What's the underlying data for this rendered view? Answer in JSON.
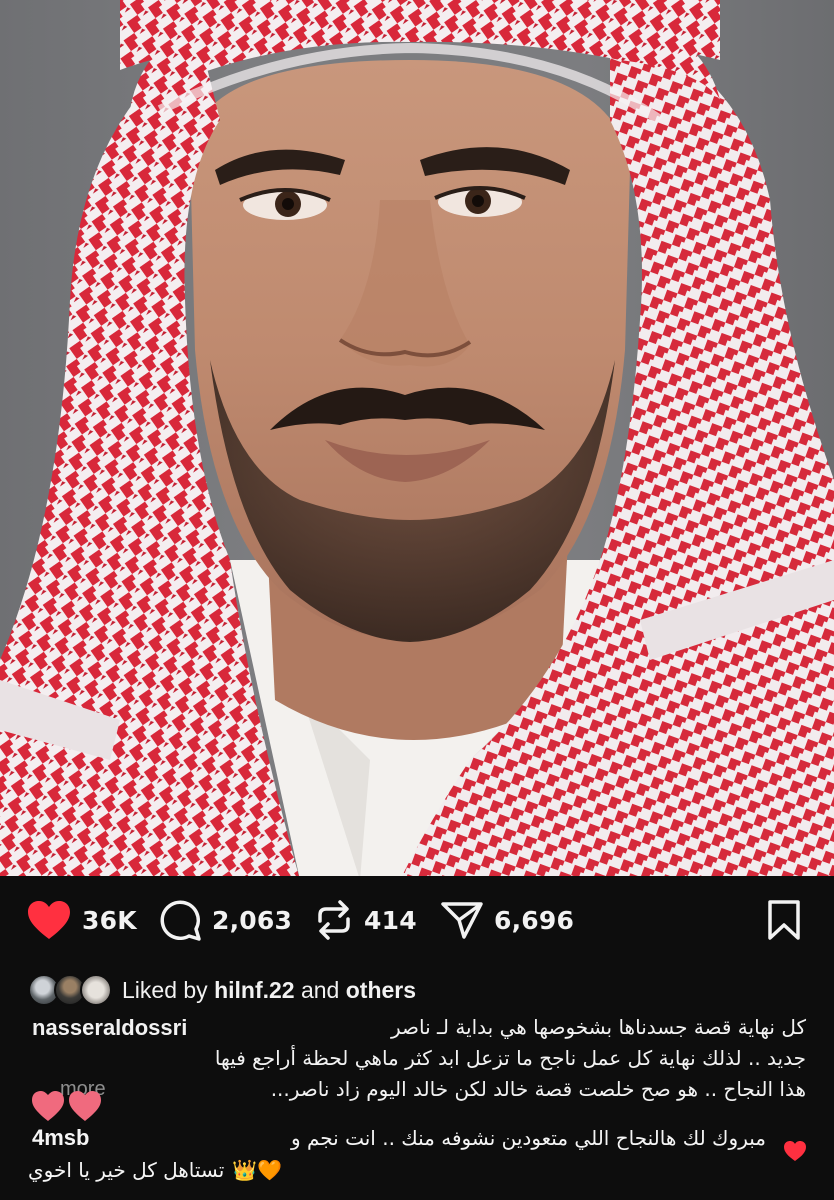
{
  "post": {
    "stats": {
      "likes": "36K",
      "comments": "2,063",
      "reposts": "414",
      "shares": "6,696"
    },
    "icons": {
      "like": "heart-filled-icon",
      "comment": "comment-bubble-icon",
      "repost": "repost-arrows-icon",
      "share": "paper-plane-icon",
      "save": "bookmark-icon"
    },
    "liked_by": {
      "prefix": "Liked by",
      "user": "hilnf.22",
      "joiner": "and",
      "suffix": "others"
    },
    "caption": {
      "username": "nasseraldossri",
      "line1": "كل نهاية قصة جسدناها بشخوصها هي بداية لـ ناصر",
      "line2": "جديد .. لذلك نهاية كل عمل ناجح ما تزعل ابد كثر ماهي لحظة أراجع فيها",
      "line3": "هذا النجاح .. هو صح خلصت قصة خالد لكن خالد اليوم زاد ناصر...",
      "more": "more"
    },
    "comment": {
      "username": "4msb",
      "line1": "مبروك لك هالنجاح اللي متعودين نشوفه منك .. انت نجم و",
      "line2": "تستاهل كل خير يا اخوي",
      "emoji": "👑🧡"
    },
    "colors": {
      "background": "#0d0d0d",
      "like_red": "#ff3040",
      "text": "#f2f2f2",
      "muted": "#8e8e8e",
      "keffiyeh_red": "#d8283a"
    }
  }
}
